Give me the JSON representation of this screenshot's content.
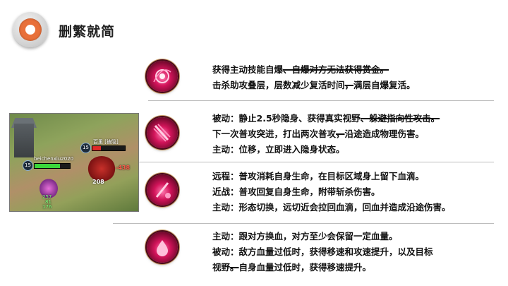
{
  "header": {
    "title": "删繁就简"
  },
  "skills": [
    {
      "icon": "spiral-blood-icon",
      "lines": [
        {
          "segments": [
            {
              "text": "获得主动技能自爆",
              "strike": false
            },
            {
              "text": "、自爆对方无法获得赏金。",
              "strike": true
            }
          ]
        },
        {
          "segments": [
            {
              "text": "击杀助攻叠层，层数减少复活时间",
              "strike": false
            },
            {
              "text": "，",
              "strike": true
            },
            {
              "text": "满层自爆复活。",
              "strike": false
            }
          ]
        }
      ]
    },
    {
      "icon": "claw-strike-icon",
      "lines": [
        {
          "segments": [
            {
              "text": "被动：静止2.5秒隐身、获得真实视野",
              "strike": false
            },
            {
              "text": "、躲避指向性攻击。",
              "strike": true
            }
          ]
        },
        {
          "segments": [
            {
              "text": "下一次普攻突进，打出两次普攻",
              "strike": false
            },
            {
              "text": "，",
              "strike": true
            },
            {
              "text": "沿途造成物理伤害。",
              "strike": false
            }
          ]
        },
        {
          "segments": [
            {
              "text": "主动：位移，立即进入隐身状态。",
              "strike": false
            }
          ]
        }
      ]
    },
    {
      "icon": "blood-blade-icon",
      "lines": [
        {
          "segments": [
            {
              "text": "远程：普攻消耗自身生命，在目标区域身上留下血滴。",
              "strike": false
            }
          ]
        },
        {
          "segments": [
            {
              "text": "近战：普攻回复自身生命，附带斩杀伤害。",
              "strike": false
            }
          ]
        },
        {
          "segments": [
            {
              "text": "主动：形态切换，远切近会拉回血滴，回血并造成沿途伤害。",
              "strike": false
            }
          ]
        }
      ]
    },
    {
      "icon": "blood-swap-icon",
      "lines": [
        {
          "segments": [
            {
              "text": "主动：跟对方换血，对方至少会保留一定血量。",
              "strike": false
            }
          ]
        },
        {
          "segments": [
            {
              "text": "被动：敌方血量过低时，获得移速和攻速提升，以及目标",
              "strike": false
            }
          ]
        },
        {
          "segments": [
            {
              "text": "视野",
              "strike": false
            },
            {
              "text": "。",
              "strike": true
            },
            {
              "text": "自身血量过低时，获得移速提升。",
              "strike": false
            }
          ]
        }
      ]
    }
  ],
  "game_screenshot": {
    "player_level": "15",
    "player_name": "beichenxiu2020",
    "enemy_level": "15",
    "enemy_name": "百里 [被隐]",
    "damage_1": "208",
    "damage_2": "-438",
    "stats": [
      "257",
      "81",
      "176"
    ],
    "player_hp_percent": 72,
    "enemy_hp_percent": 25
  },
  "colors": {
    "accent_orange": "#e8703a",
    "skill_red": "#d2145a",
    "divider": "#bdbdbd"
  }
}
